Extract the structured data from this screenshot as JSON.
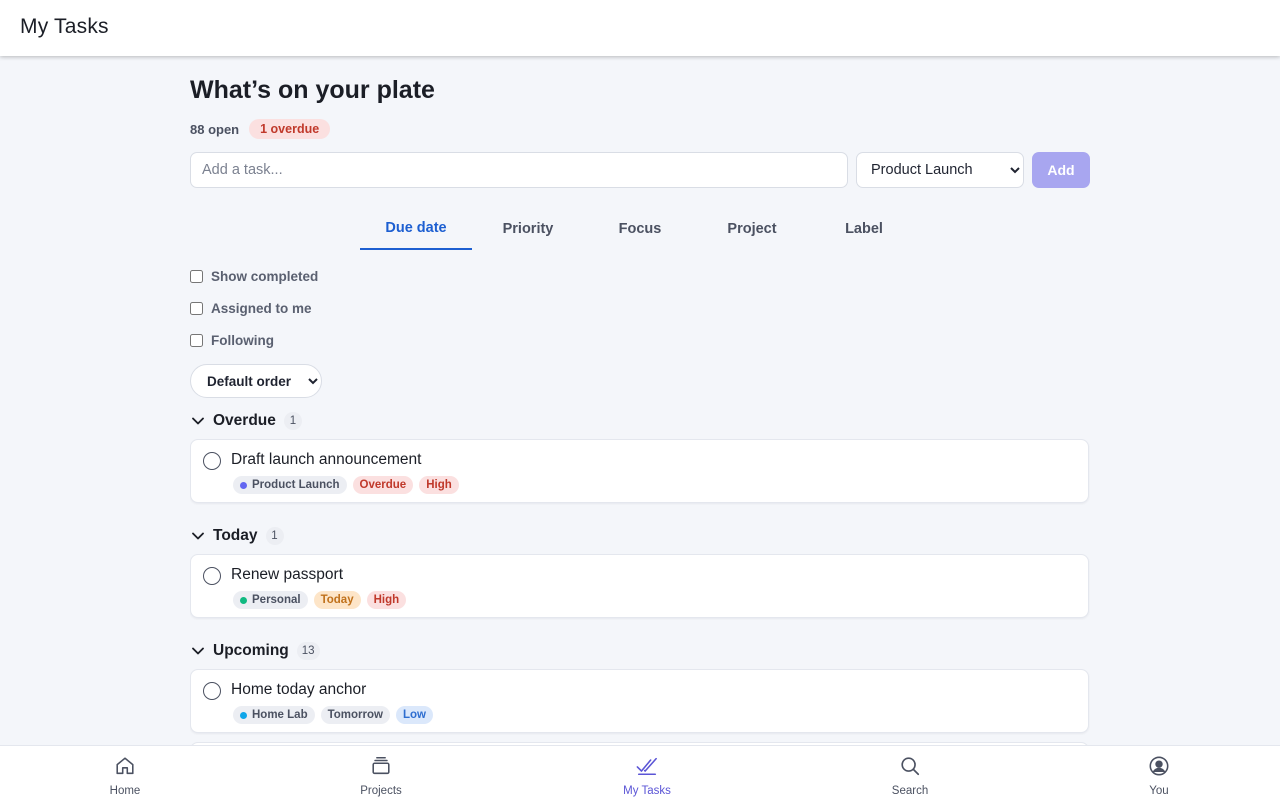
{
  "topbar": {
    "title": "My Tasks"
  },
  "header": {
    "heading": "What’s on your plate",
    "open_count": "88 open",
    "overdue_badge": "1 overdue"
  },
  "add_task": {
    "placeholder": "Add a task...",
    "project_selected": "Product Launch",
    "add_label": "Add"
  },
  "tabs": [
    {
      "label": "Due date",
      "active": true
    },
    {
      "label": "Priority",
      "active": false
    },
    {
      "label": "Focus",
      "active": false
    },
    {
      "label": "Project",
      "active": false
    },
    {
      "label": "Label",
      "active": false
    }
  ],
  "filters": [
    {
      "label": "Show completed",
      "checked": false
    },
    {
      "label": "Assigned to me",
      "checked": false
    },
    {
      "label": "Following",
      "checked": false
    }
  ],
  "sort": {
    "selected": "Default order"
  },
  "groups": [
    {
      "name": "Overdue",
      "count": "1",
      "tasks": [
        {
          "title": "Draft launch announcement",
          "project": "Product Launch",
          "project_color": "#6366f1",
          "due": "Overdue",
          "priority": "High"
        }
      ]
    },
    {
      "name": "Today",
      "count": "1",
      "tasks": [
        {
          "title": "Renew passport",
          "project": "Personal",
          "project_color": "#10b981",
          "due": "Today",
          "priority": "High"
        }
      ]
    },
    {
      "name": "Upcoming",
      "count": "13",
      "tasks": [
        {
          "title": "Home today anchor",
          "project": "Home Lab",
          "project_color": "#0ea5e9",
          "due": "Tomorrow",
          "priority": "Low"
        }
      ]
    }
  ],
  "bottom_nav": [
    {
      "label": "Home",
      "icon": "home-icon",
      "active": false
    },
    {
      "label": "Projects",
      "icon": "projects-icon",
      "active": false
    },
    {
      "label": "My Tasks",
      "icon": "double-check-icon",
      "active": true
    },
    {
      "label": "Search",
      "icon": "search-icon",
      "active": false
    },
    {
      "label": "You",
      "icon": "user-circle-icon",
      "active": false
    }
  ],
  "colors": {
    "accent": "#1d5fd1",
    "nav_active": "#5b55d6",
    "add_button": "#a8a6f0",
    "danger": "#c0392b"
  }
}
